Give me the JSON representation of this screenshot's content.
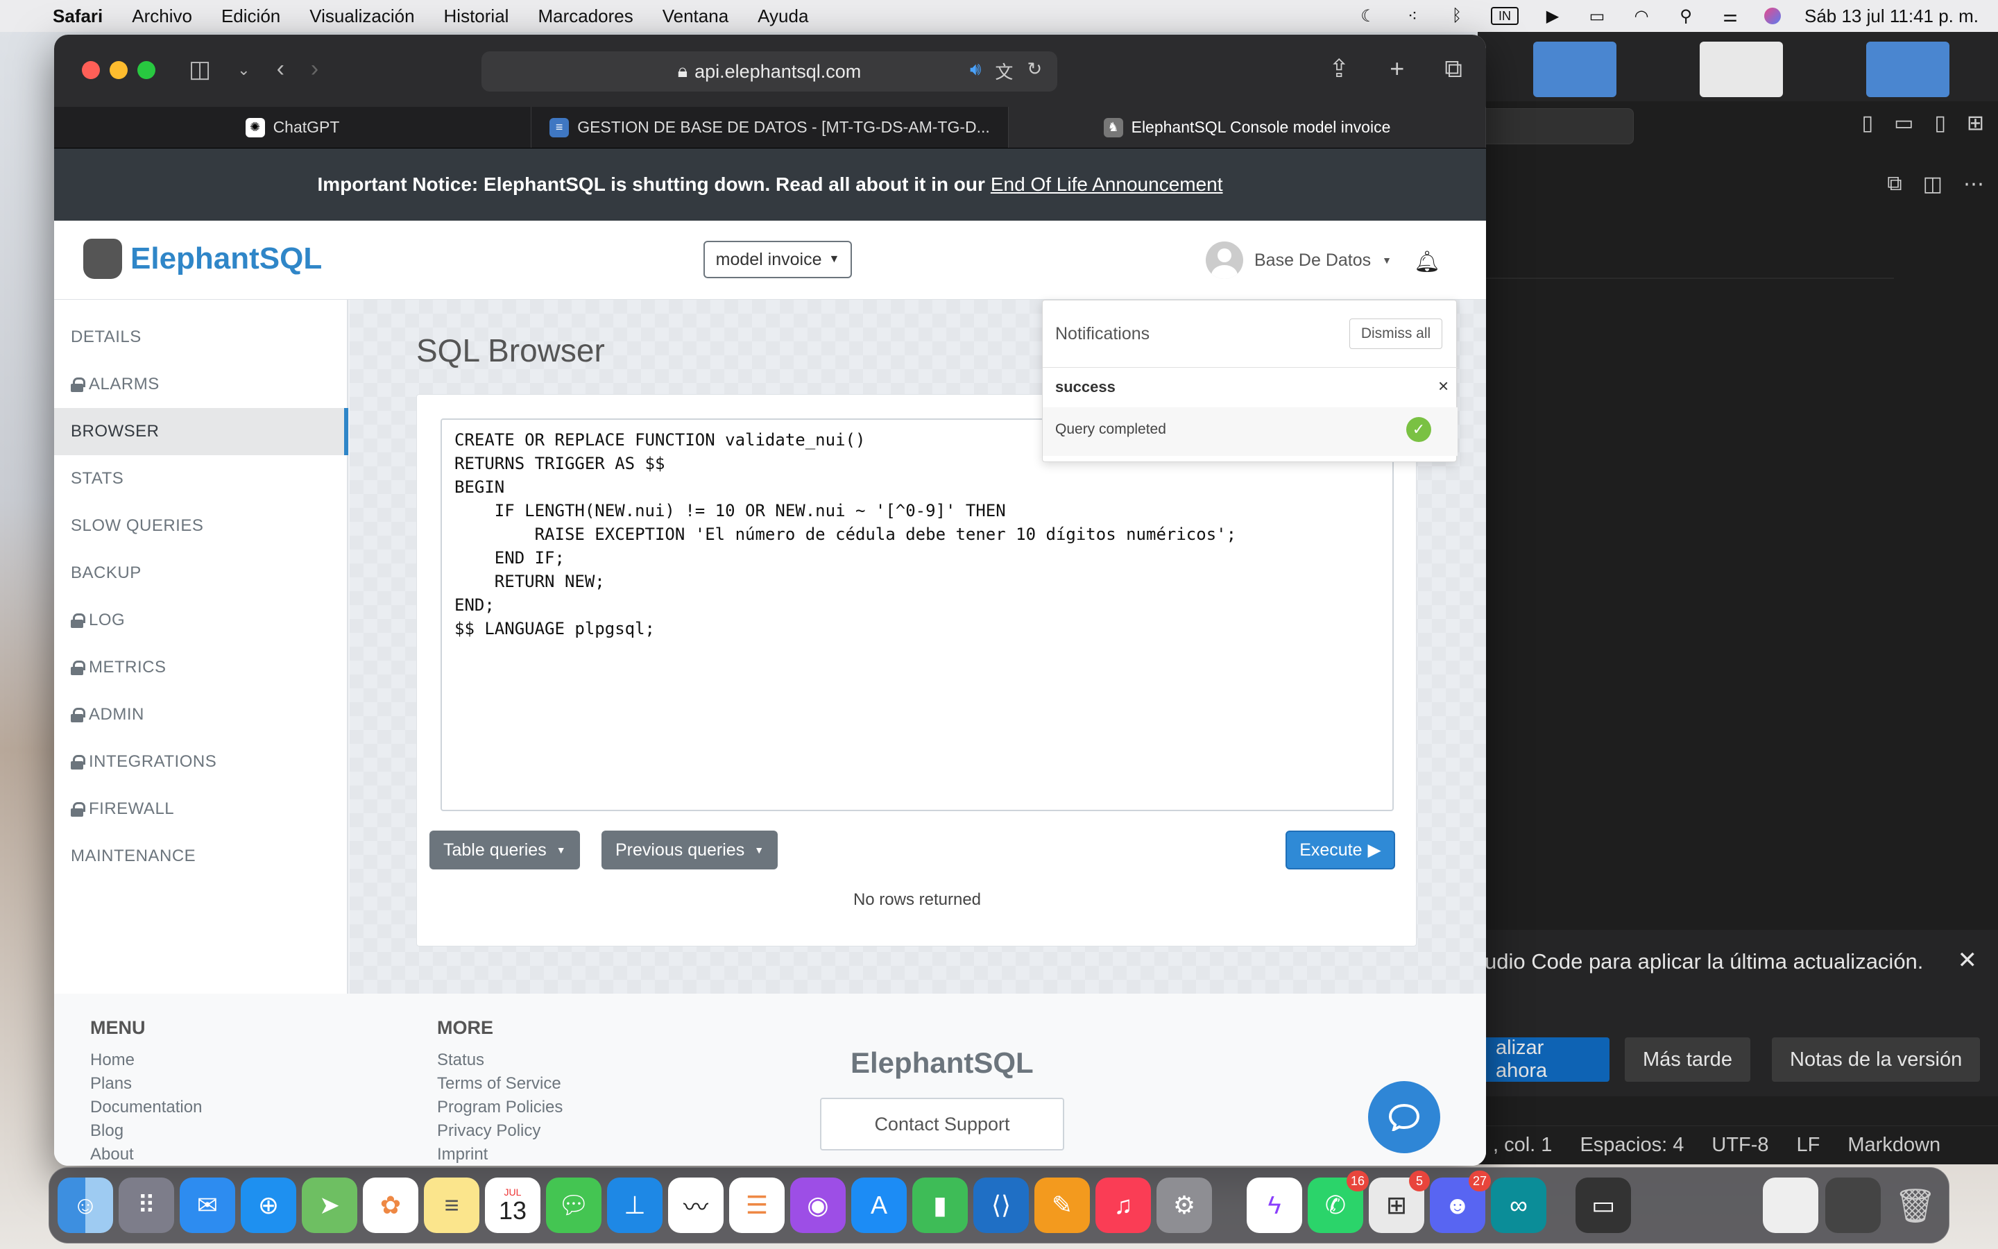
{
  "menubar": {
    "app": "Safari",
    "items": [
      "Archivo",
      "Edición",
      "Visualización",
      "Historial",
      "Marcadores",
      "Ventana",
      "Ayuda"
    ],
    "input_source": "IN",
    "datetime": "Sáb 13 jul  11:41 p. m."
  },
  "safari": {
    "url": "api.elephantsql.com",
    "tabs": [
      {
        "label": "ChatGPT"
      },
      {
        "label": "GESTION DE BASE DE DATOS - [MT-TG-DS-AM-TG-D..."
      },
      {
        "label": "ElephantSQL Console model invoice"
      }
    ]
  },
  "notice": {
    "text": "Important Notice: ElephantSQL is shutting down. Read all about it in our",
    "link": "End Of Life Announcement"
  },
  "header": {
    "logo_text": "ElephantSQL",
    "instance_select": "model invoice",
    "user_name": "Base De Datos"
  },
  "sidebar": {
    "items": [
      {
        "label": "DETAILS",
        "locked": false
      },
      {
        "label": "ALARMS",
        "locked": true
      },
      {
        "label": "BROWSER",
        "locked": false,
        "active": true
      },
      {
        "label": "STATS",
        "locked": false
      },
      {
        "label": "SLOW QUERIES",
        "locked": false
      },
      {
        "label": "BACKUP",
        "locked": false
      },
      {
        "label": "LOG",
        "locked": true
      },
      {
        "label": "METRICS",
        "locked": true
      },
      {
        "label": "ADMIN",
        "locked": true
      },
      {
        "label": "INTEGRATIONS",
        "locked": true
      },
      {
        "label": "FIREWALL",
        "locked": true
      },
      {
        "label": "MAINTENANCE",
        "locked": false
      }
    ]
  },
  "browser": {
    "title": "SQL Browser",
    "query": "CREATE OR REPLACE FUNCTION validate_nui()\nRETURNS TRIGGER AS $$\nBEGIN\n    IF LENGTH(NEW.nui) != 10 OR NEW.nui ~ '[^0-9]' THEN\n        RAISE EXCEPTION 'El número de cédula debe tener 10 dígitos numéricos';\n    END IF;\n    RETURN NEW;\nEND;\n$$ LANGUAGE plpgsql;",
    "table_queries_label": "Table queries",
    "previous_queries_label": "Previous queries",
    "execute_label": "Execute",
    "result_text": "No rows returned"
  },
  "notifications": {
    "title": "Notifications",
    "dismiss_label": "Dismiss all",
    "type": "success",
    "close_glyph": "×",
    "message": "Query completed"
  },
  "footer": {
    "menu_title": "MENU",
    "menu_links": [
      "Home",
      "Plans",
      "Documentation",
      "Blog",
      "About"
    ],
    "more_title": "MORE",
    "more_links": [
      "Status",
      "Terms of Service",
      "Program Policies",
      "Privacy Policy",
      "Imprint"
    ],
    "brand": "ElephantSQL",
    "contact_label": "Contact Support"
  },
  "vscode": {
    "notice_text": "udio Code para aplicar la última actualización.",
    "btn_update": "alizar ahora",
    "btn_later": "Más tarde",
    "btn_notes": "Notas de la versión",
    "status": [
      ", col. 1",
      "Espacios: 4",
      "UTF-8",
      "LF",
      "Markdown"
    ]
  },
  "dock": {
    "calendar_month": "JUL",
    "calendar_day": "13",
    "badges": {
      "whatsapp": "16",
      "installer": "5",
      "discord": "27"
    }
  },
  "colors": {
    "accent": "#2f86c8",
    "notice_bg": "#343a40",
    "execute_bg": "#2f8ad6",
    "success": "#7ac143"
  }
}
